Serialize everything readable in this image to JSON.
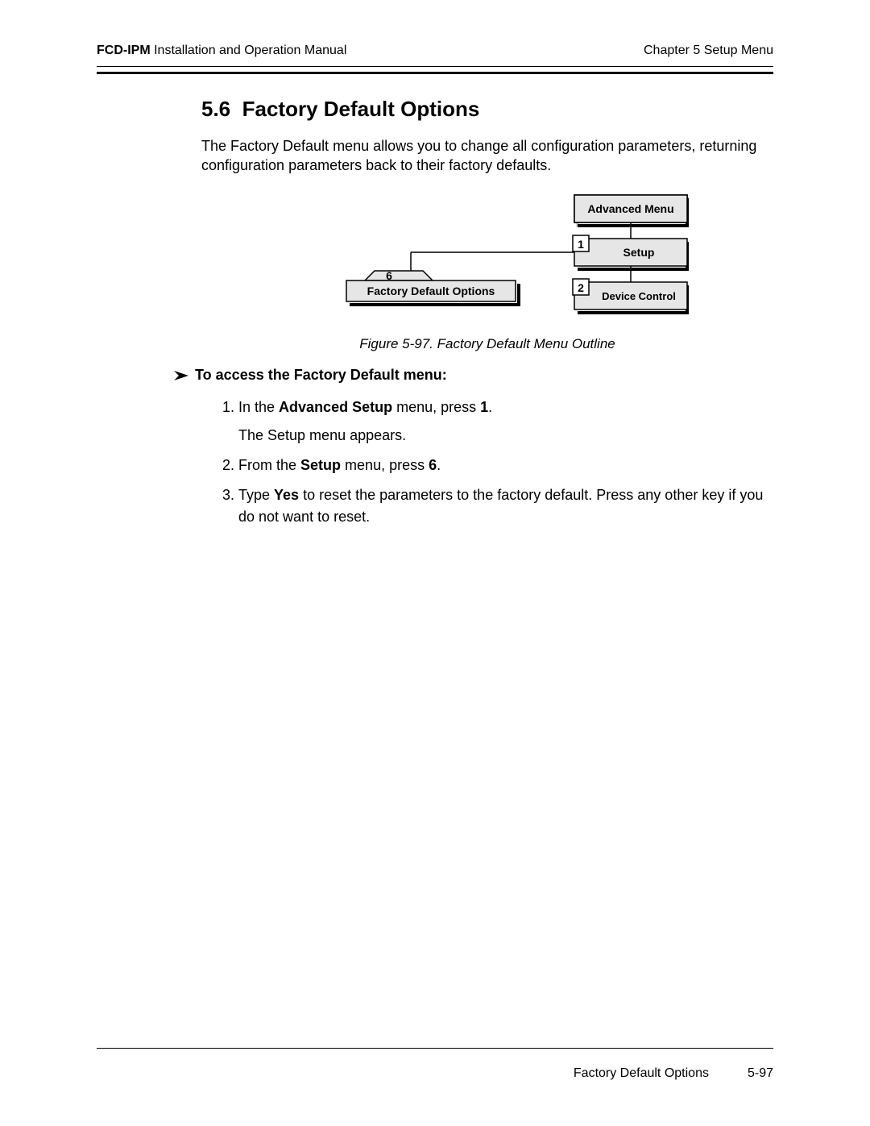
{
  "header": {
    "product": "FCD-IPM",
    "manual": "Installation and Operation Manual",
    "chapter": "Chapter 5  Setup Menu"
  },
  "section": {
    "number": "5.6",
    "title": "Factory Default Options",
    "intro": "The Factory Default menu allows you to change all configuration parameters, returning configuration parameters back to their factory defaults."
  },
  "diagram": {
    "boxes": {
      "advanced": "Advanced Menu",
      "setup": {
        "num": "1",
        "label": "Setup"
      },
      "device": {
        "num": "2",
        "label": "Device Control"
      },
      "factory": {
        "num": "6",
        "label": "Factory Default Options"
      }
    }
  },
  "caption": "Figure 5-97.  Factory Default Menu Outline",
  "procedure": {
    "heading": "To access the Factory Default menu:",
    "steps": [
      {
        "pre": "In the ",
        "bold1": "Advanced Setup",
        "mid1": " menu, press ",
        "bold2": "1",
        "post": ".",
        "sub": "The Setup menu appears."
      },
      {
        "pre": "From the ",
        "bold1": "Setup",
        "mid1": " menu, press ",
        "bold2": "6",
        "post": "."
      },
      {
        "pre": "Type ",
        "bold1": "Yes",
        "mid1": " to reset the parameters to the factory default. Press any other key if you do not want to reset.",
        "bold2": "",
        "post": ""
      }
    ]
  },
  "footer": {
    "title": "Factory Default Options",
    "page": "5-97"
  }
}
